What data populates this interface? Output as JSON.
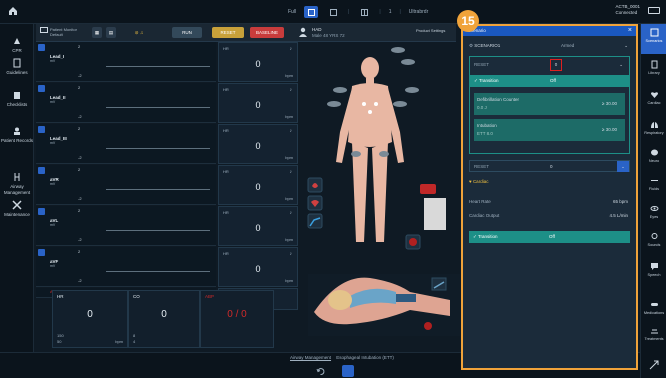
{
  "topbar": {
    "center_label": "Full",
    "center_page": "1",
    "center_label2": "Ultrabrdr",
    "right_line1": "ACTB_0001",
    "right_line2": "Connected",
    "buttons": [
      "screen-a",
      "screen-b",
      "screen-c",
      "screen-d"
    ]
  },
  "leftnav": {
    "items": [
      {
        "label": "CPR",
        "icon": "cpr-icon"
      },
      {
        "label": "Guidelines",
        "icon": "doc-icon"
      },
      {
        "label": "Checklists",
        "icon": "clipboard-icon"
      },
      {
        "label": "Patient Records",
        "icon": "records-icon"
      },
      {
        "label": "Airway Management",
        "icon": "airway-icon"
      },
      {
        "label": "Maintenance",
        "icon": "tools-icon"
      }
    ]
  },
  "monitor_header": {
    "title_line1": "Patient Monitor",
    "title_line2": "Default",
    "btn_run": "RUN",
    "btn_reset": "RESET",
    "btn_baseline": "BASELINE",
    "patient_name": "HAD",
    "patient_sub": "Male 48 YRS 72",
    "product_label": "Product Settings"
  },
  "waveforms": [
    {
      "label": "Lead_I",
      "unit": "mV",
      "top": "2",
      "bottom": "-2"
    },
    {
      "label": "Lead_II",
      "unit": "mV",
      "top": "2",
      "bottom": "-2"
    },
    {
      "label": "Lead_III",
      "unit": "mV",
      "top": "2",
      "bottom": "-2"
    },
    {
      "label": "aVR",
      "unit": "mV",
      "top": "2",
      "bottom": "-2"
    },
    {
      "label": "aVL",
      "unit": "mV",
      "top": "2",
      "bottom": "-2"
    },
    {
      "label": "aVF",
      "unit": "mV",
      "top": "2",
      "bottom": "-2"
    },
    {
      "label": "ABP",
      "unit": "",
      "top": "",
      "bottom": "300"
    }
  ],
  "params": [
    {
      "name": "HR",
      "value": "0",
      "unit": "bpm"
    },
    {
      "name": "HR",
      "value": "0",
      "unit": "bpm"
    },
    {
      "name": "HR",
      "value": "0",
      "unit": "bpm"
    },
    {
      "name": "HR",
      "value": "0",
      "unit": "bpm"
    },
    {
      "name": "HR",
      "value": "0",
      "unit": "bpm"
    },
    {
      "name": "HR",
      "value": "0",
      "unit": "bpm"
    },
    {
      "name": "ABP",
      "value": "0 / 0",
      "unit": ""
    }
  ],
  "bottom_boxes": [
    {
      "name": "HR",
      "value": "0",
      "unit": "bpm",
      "hi": "150",
      "lo": "50"
    },
    {
      "name": "CO",
      "value": "0",
      "unit": "",
      "hi": "8",
      "lo": "4"
    },
    {
      "name": "ABP",
      "value": "0 / 0",
      "unit": "",
      "hi": "",
      "lo": ""
    }
  ],
  "bottom_status": "Airway Management",
  "bottom_status2": "Esophageal Intubation (ETT)",
  "panel": {
    "title": "Scenario",
    "scenario_name": "SCENARIO1",
    "scenario_state": "Armed",
    "stage_label": "RESET",
    "stage_value": "0",
    "transition_label": "Transition",
    "transition_state": "Off",
    "defib_label": "Defibrillation Counter",
    "defib_sub": "0.0 J",
    "defib_op": "≥ 30.00",
    "intubation_label": "Intubation",
    "intubation_sub": "ETT 8.0",
    "intubation_op": "≥ 30.00",
    "stage2_label": "RESET",
    "stage2_value": "0",
    "cardiac_header": "Cardiac",
    "heart_rate_label": "Heart Rate",
    "heart_rate_value": "65 bpm",
    "co_label": "Cardiac Output",
    "co_value": "4.5 L/min",
    "transition2_label": "Transition",
    "transition2_state": "Off",
    "badge": "15"
  },
  "rightnav": {
    "items": [
      {
        "label": "Scenarios",
        "icon": "scenario-icon",
        "active": true
      },
      {
        "label": "Library",
        "icon": "library-icon"
      },
      {
        "label": "Cardiac",
        "icon": "heart-icon"
      },
      {
        "label": "Respiratory",
        "icon": "lungs-icon"
      },
      {
        "label": "Neuro",
        "icon": "brain-icon"
      },
      {
        "label": "Fluids",
        "icon": "fluids-icon"
      },
      {
        "label": "Eyes",
        "icon": "eye-icon"
      },
      {
        "label": "Sounds",
        "icon": "sound-icon"
      },
      {
        "label": "Speech",
        "icon": "speech-icon"
      },
      {
        "label": "Medications",
        "icon": "pills-icon"
      },
      {
        "label": "Treatments",
        "icon": "treatment-icon"
      }
    ]
  },
  "colors": {
    "accent": "#2a63c7",
    "panel_border": "#f0a33a",
    "teal": "#1d8f87",
    "reset_btn": "#c8a13a",
    "baseline_btn": "#c83c3c",
    "alarm_red": "#d02a2a"
  }
}
